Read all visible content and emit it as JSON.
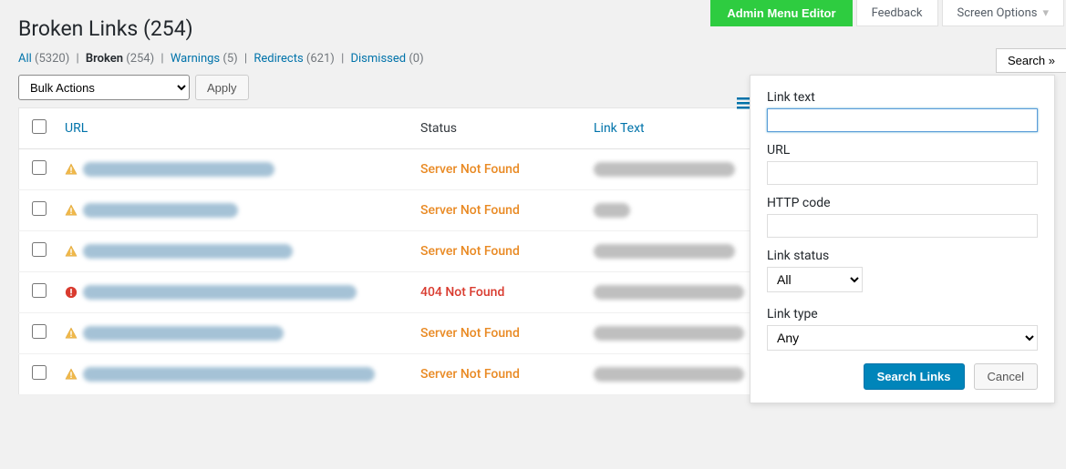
{
  "top": {
    "admin_menu_editor": "Admin Menu Editor",
    "feedback": "Feedback",
    "screen_options": "Screen Options"
  },
  "title": {
    "text": "Broken Links",
    "count": "(254)"
  },
  "filters": {
    "all": {
      "label": "All",
      "count": "(5320)"
    },
    "broken": {
      "label": "Broken",
      "count": "(254)"
    },
    "warnings": {
      "label": "Warnings",
      "count": "(5)"
    },
    "redirects": {
      "label": "Redirects",
      "count": "(621)"
    },
    "dismissed": {
      "label": "Dismissed",
      "count": "(0)"
    }
  },
  "bulk": {
    "placeholder": "Bulk Actions",
    "apply": "Apply"
  },
  "search_trigger": "Search »",
  "columns": {
    "url": "URL",
    "status": "Status",
    "link_text": "Link Text"
  },
  "status_labels": {
    "server_nf": "Server Not Found",
    "http_404": "404 Not Found"
  },
  "rows": [
    {
      "icon": "warn",
      "status": "server_nf",
      "url_w": 210,
      "lt_w": 155
    },
    {
      "icon": "warn",
      "status": "server_nf",
      "url_w": 170,
      "lt_w": 40
    },
    {
      "icon": "warn",
      "status": "server_nf",
      "url_w": 230,
      "lt_w": 155
    },
    {
      "icon": "err",
      "status": "http_404",
      "url_w": 300,
      "lt_w": 165
    },
    {
      "icon": "warn",
      "status": "server_nf",
      "url_w": 220,
      "lt_w": 165
    },
    {
      "icon": "warn",
      "status": "server_nf",
      "url_w": 320,
      "lt_w": 165
    }
  ],
  "search_panel": {
    "link_text_label": "Link text",
    "url_label": "URL",
    "http_code_label": "HTTP code",
    "link_status_label": "Link status",
    "link_status_selected": "All",
    "link_type_label": "Link type",
    "link_type_selected": "Any",
    "submit": "Search Links",
    "cancel": "Cancel"
  }
}
